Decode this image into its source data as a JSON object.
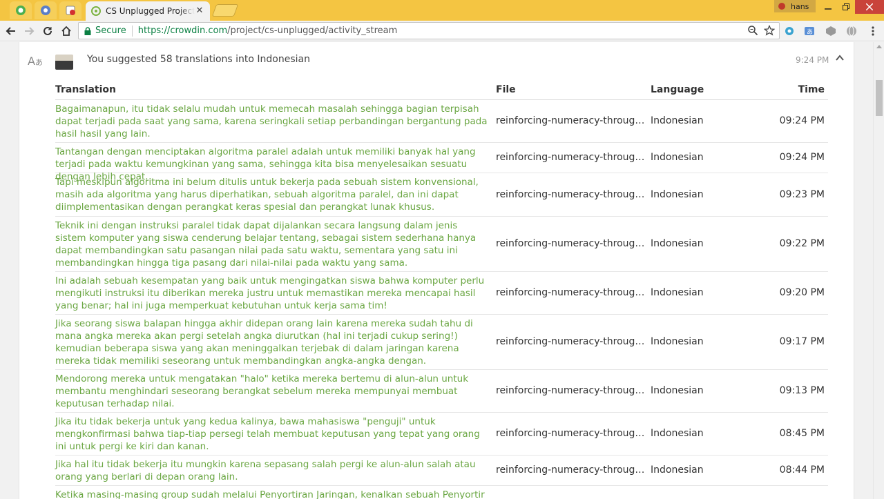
{
  "browser": {
    "active_tab_title": "CS Unplugged Project Activity Stream",
    "user": "hans",
    "secure_label": "Secure",
    "url_scheme": "https://",
    "url_host": "crowdin.com",
    "url_path": "/project/cs-unplugged/activity_stream"
  },
  "activity": {
    "summary": "You suggested 58 translations into Indonesian",
    "time": "9:24 PM"
  },
  "table": {
    "headers": {
      "translation": "Translation",
      "file": "File",
      "language": "Language",
      "time": "Time"
    },
    "rows": [
      {
        "translation": "Bagaimanapun, itu tidak selalu mudah untuk memecah masalah sehingga bagian terpisah dapat terjadi pada saat yang sama, karena seringkali setiap perbandingan bergantung pada hasil hasil yang lain.",
        "file": "reinforcing-numeracy-through-a...",
        "language": "Indonesian",
        "time": "09:24 PM"
      },
      {
        "translation": "Tantangan dengan menciptakan algoritma paralel adalah untuk memiliki banyak hal yang terjadi pada waktu kemungkinan yang sama, sehingga kita bisa menyelesaikan sesuatu dengan lebih cepat.",
        "file": "reinforcing-numeracy-through-a...",
        "language": "Indonesian",
        "time": "09:24 PM"
      },
      {
        "translation": "Tapi meskipun algoritma ini belum ditulis untuk bekerja pada sebuah sistem konvensional, masih ada algoritma yang harus diperhatikan, sebuah algoritma paralel, dan ini dapat diimplementasikan dengan perangkat keras spesial dan perangkat lunak khusus.",
        "file": "reinforcing-numeracy-through-a...",
        "language": "Indonesian",
        "time": "09:23 PM"
      },
      {
        "translation": "Teknik ini dengan instruksi paralel tidak dapat dijalankan secara langsung dalam jenis sistem komputer yang siswa cenderung belajar tentang, sebagai sistem sederhana hanya dapat membandingkan satu pasangan nilai pada satu waktu, sementara yang satu ini membandingkan hingga tiga pasang dari nilai-nilai pada waktu yang sama.",
        "file": "reinforcing-numeracy-through-a...",
        "language": "Indonesian",
        "time": "09:22 PM"
      },
      {
        "translation": "Ini adalah sebuah kesempatan yang baik untuk mengingatkan siswa bahwa komputer perlu mengikuti instruksi itu diberikan mereka justru untuk memastikan mereka mencapai hasil yang benar; hal ini juga memperkuat kebutuhan untuk kerja sama tim!",
        "file": "reinforcing-numeracy-through-a...",
        "language": "Indonesian",
        "time": "09:20 PM"
      },
      {
        "translation": "Jika seorang siswa balapan hingga akhir didepan orang lain karena mereka sudah tahu di mana angka mereka akan pergi setelah angka diurutkan (hal ini terjadi cukup sering!) kemudian beberapa siswa yang akan meninggalkan terjebak di dalam jaringan karena mereka tidak memiliki seseorang untuk membandingkan angka-angka dengan.",
        "file": "reinforcing-numeracy-through-a...",
        "language": "Indonesian",
        "time": "09:17 PM"
      },
      {
        "translation": "Mendorong mereka untuk mengatakan \"halo\" ketika mereka bertemu di alun-alun untuk membantu menghindari seseorang berangkat sebelum mereka mempunyai membuat keputusan terhadap nilai.",
        "file": "reinforcing-numeracy-through-a...",
        "language": "Indonesian",
        "time": "09:13 PM"
      },
      {
        "translation": "Jika itu tidak bekerja untuk yang kedua kalinya, bawa mahasiswa \"penguji\" untuk mengkonfirmasi bahwa tiap-tiap persegi telah membuat keputusan yang tepat yang orang ini untuk pergi ke kiri dan kanan.",
        "file": "reinforcing-numeracy-through-a...",
        "language": "Indonesian",
        "time": "08:45 PM"
      },
      {
        "translation": "Jika hal itu tidak bekerja itu mungkin karena sepasang salah pergi ke alun-alun salah atau orang yang berlari di depan orang lain.",
        "file": "reinforcing-numeracy-through-a...",
        "language": "Indonesian",
        "time": "08:44 PM"
      },
      {
        "translation": "Ketika masing-masing group sudah melalui Penyortiran Jaringan, kenalkan sebuah Penyortir",
        "file": "",
        "language": "",
        "time": ""
      }
    ]
  }
}
